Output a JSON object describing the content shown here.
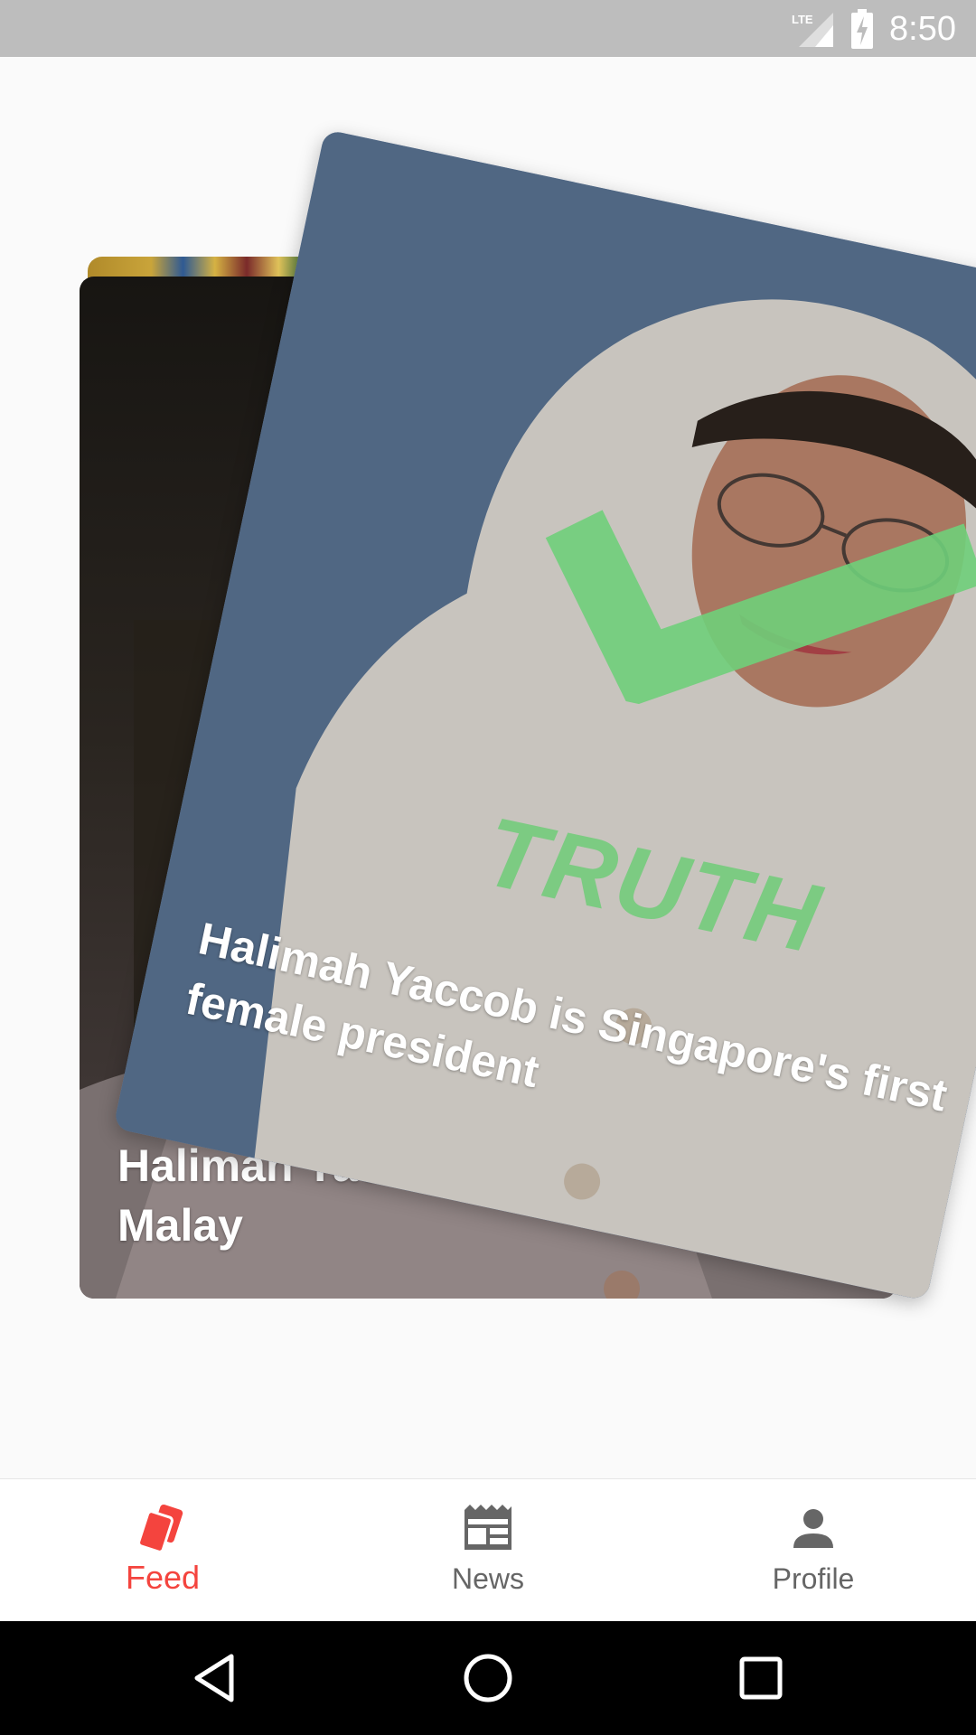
{
  "status_bar": {
    "time": "8:50",
    "network_label": "LTE",
    "icons": [
      "lte-signal-icon",
      "battery-charging-icon"
    ]
  },
  "feed": {
    "front_card": {
      "title": "Halimah Yaccob is Singapore's first female president",
      "verdict": "TRUTH",
      "verdict_icon": "check-mark-icon",
      "verdict_color": "#6fcf7a"
    },
    "back_card": {
      "title": "Halimah Yaccob is an Indian not a Malay"
    }
  },
  "bottom_nav": {
    "items": [
      {
        "label": "Feed",
        "icon": "cards-icon",
        "active": true
      },
      {
        "label": "News",
        "icon": "newspaper-icon",
        "active": false
      },
      {
        "label": "Profile",
        "icon": "person-icon",
        "active": false
      }
    ],
    "active_color": "#f4443e",
    "inactive_color": "#666666"
  },
  "system_nav": {
    "buttons": [
      "back-icon",
      "home-icon",
      "recents-icon"
    ]
  }
}
